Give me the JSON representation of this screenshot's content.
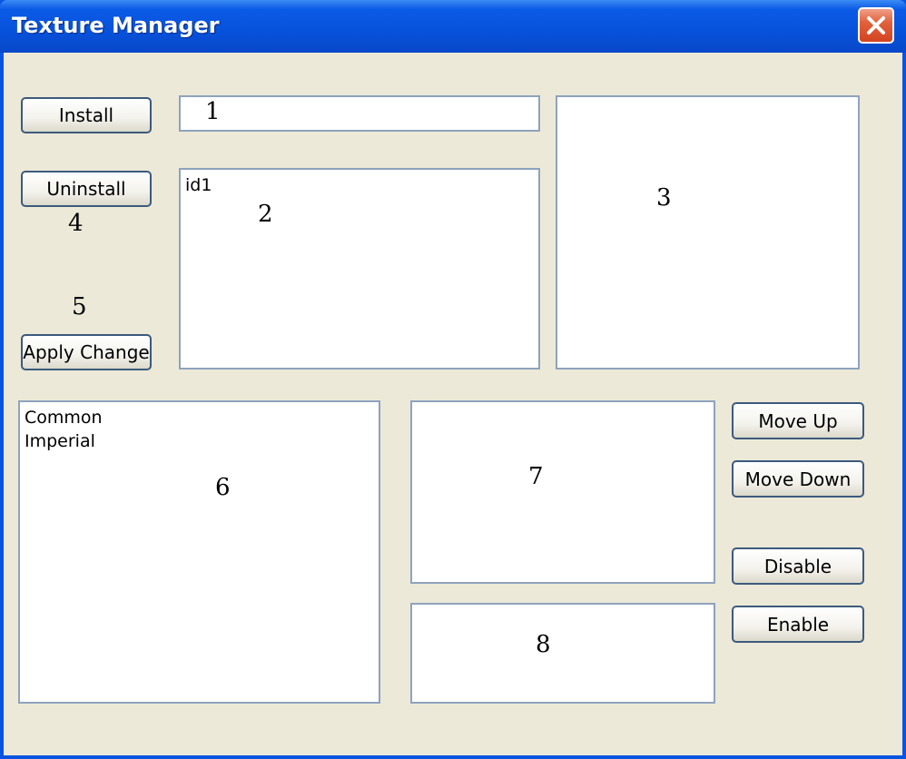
{
  "window": {
    "title": "Texture Manager",
    "close_icon": "close-x-icon",
    "accent_color": "#0a55e0",
    "client_bg": "#ece9d8"
  },
  "buttons": {
    "install": "Install",
    "uninstall": "Uninstall",
    "apply_change": "Apply Change",
    "move_up": "Move Up",
    "move_down": "Move Down",
    "disable": "Disable",
    "enable": "Enable"
  },
  "fields": {
    "field1": {
      "value": ""
    },
    "list2": {
      "items": [
        "id1"
      ]
    },
    "list6": {
      "items": [
        "Common",
        "Imperial"
      ]
    }
  },
  "labels": {
    "n1": "1",
    "n2": "2",
    "n3": "3",
    "n4": "4",
    "n5": "5",
    "n6": "6",
    "n7": "7",
    "n8": "8"
  }
}
